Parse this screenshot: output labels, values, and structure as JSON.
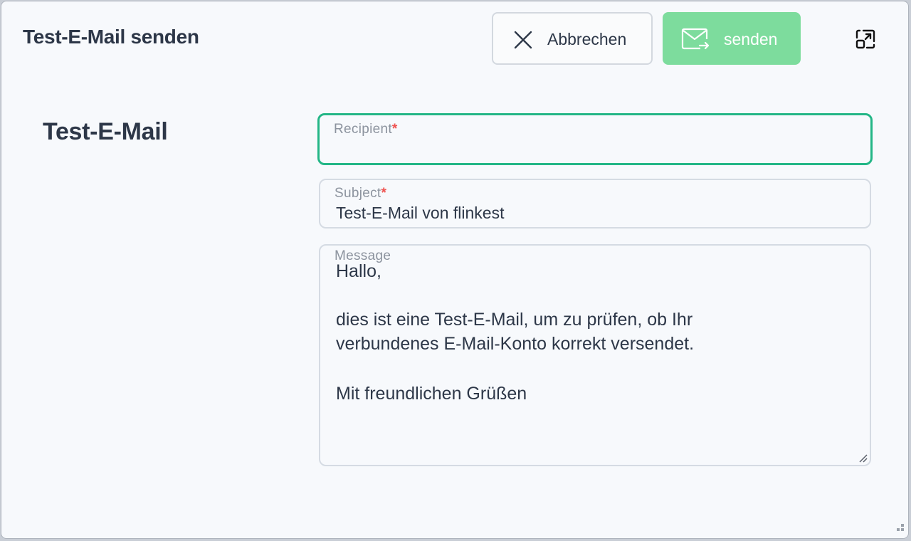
{
  "dialog": {
    "title": "Test-E-Mail senden",
    "cancel_label": "Abbrechen",
    "send_label": "senden"
  },
  "section": {
    "title": "Test-E-Mail"
  },
  "form": {
    "recipient": {
      "label": "Recipient",
      "required": "*",
      "value": ""
    },
    "subject": {
      "label": "Subject",
      "required": "*",
      "value": "Test-E-Mail von flinkest"
    },
    "message": {
      "label": "Message",
      "lines": [
        "Hallo,",
        "",
        "dies ist eine Test-E-Mail, um zu prüfen, ob Ihr",
        "verbundenes E-Mail-Konto korrekt versendet.",
        "",
        "Mit freundlichen Grüßen"
      ]
    }
  },
  "icons": {
    "cancel": "close-icon",
    "send": "mail-send-icon",
    "expand": "expand-icon"
  },
  "colors": {
    "send_button": "#7ddc9d",
    "focus_border": "#23b686",
    "required": "#ef5350",
    "text": "#2d3748"
  }
}
